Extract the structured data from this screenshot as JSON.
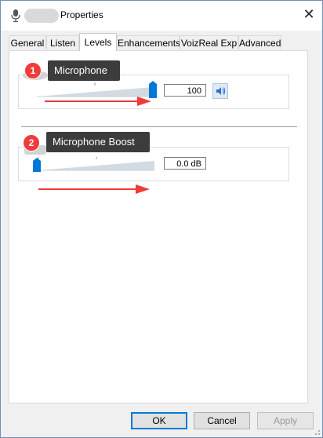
{
  "window": {
    "title": "Properties",
    "close_glyph": "✕"
  },
  "tabs": [
    {
      "label": "General"
    },
    {
      "label": "Listen"
    },
    {
      "label": "Levels"
    },
    {
      "label": "Enhancements"
    },
    {
      "label": "VoizReal Exp"
    },
    {
      "label": "Advanced"
    }
  ],
  "active_tab": "Levels",
  "microphone": {
    "callout_label": "Microphone",
    "callout_number": "1",
    "value": "100",
    "slider_level": 1.0,
    "speaker_icon": "speaker-icon"
  },
  "boost": {
    "callout_label": "Microphone Boost",
    "callout_number": "2",
    "value": "0.0 dB",
    "slider_level": 0.0
  },
  "buttons": {
    "ok": "OK",
    "cancel": "Cancel",
    "apply": "Apply"
  },
  "colors": {
    "accent": "#0078d7",
    "annotation_red": "#f03b3b",
    "callout_bg": "#3c3c3c"
  }
}
